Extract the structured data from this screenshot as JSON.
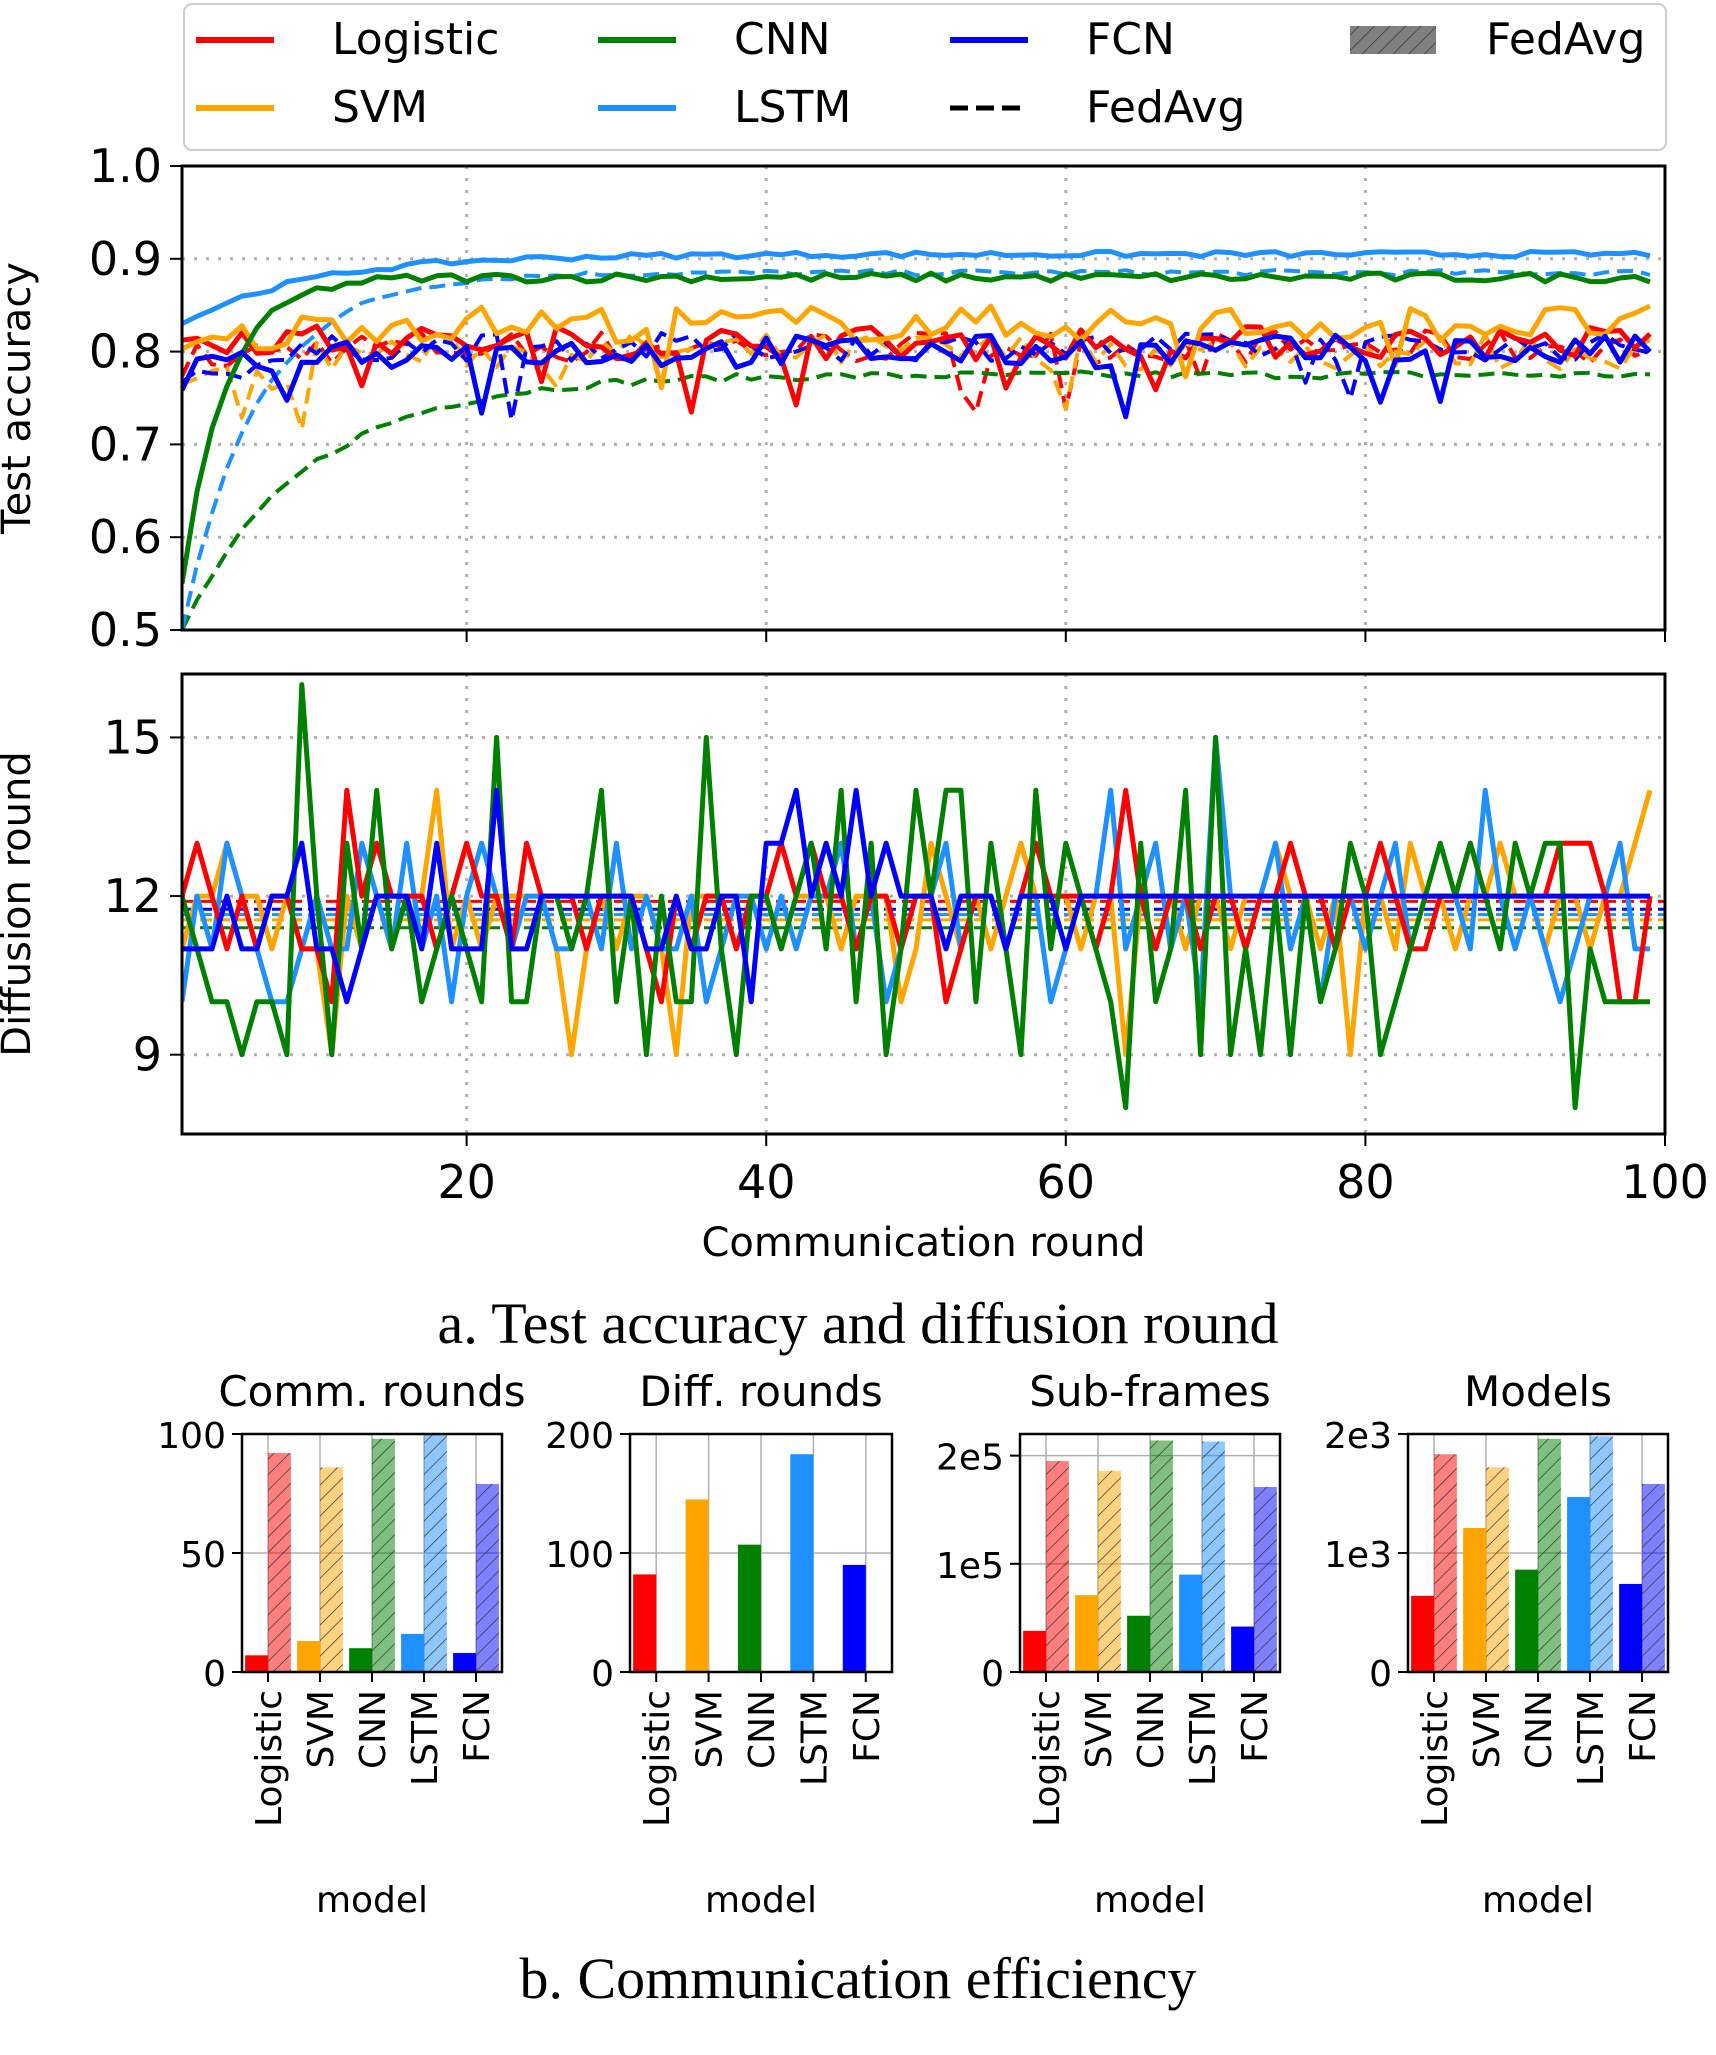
{
  "colors": {
    "Logistic": "#ff0000",
    "SVM": "#ffa500",
    "CNN": "#008000",
    "LSTM": "#1e90ff",
    "FCN": "#0000ff",
    "grid": "#b0b0b0",
    "fedavg_patch": "#808080"
  },
  "captions": {
    "a": "a. Test accuracy and diffusion round",
    "b": "b. Communication efficiency"
  },
  "legend": {
    "placement": "top (above plots)",
    "entries": [
      {
        "label": "Logistic",
        "kind": "line",
        "color_key": "Logistic"
      },
      {
        "label": "CNN",
        "kind": "line",
        "color_key": "CNN"
      },
      {
        "label": "FCN",
        "kind": "line",
        "color_key": "FCN"
      },
      {
        "label": "FedAvg",
        "kind": "hatch-patch",
        "color_key": "fedavg_patch"
      },
      {
        "label": "SVM",
        "kind": "line",
        "color_key": "SVM"
      },
      {
        "label": "LSTM",
        "kind": "line",
        "color_key": "LSTM"
      },
      {
        "label": "FedAvg",
        "kind": "dashed-line",
        "color_key": "black"
      }
    ]
  },
  "chart_data": [
    {
      "type": "line",
      "id": "test-accuracy",
      "ylabel": "Test accuracy",
      "xlabel": "",
      "xlim": [
        1,
        100
      ],
      "ylim": [
        0.5,
        1.0
      ],
      "xticks": [
        20,
        40,
        60,
        80,
        100
      ],
      "yticks": [
        0.5,
        0.6,
        0.7,
        0.8,
        0.9,
        1.0
      ],
      "ytick_labels": [
        "0.5",
        "0.6",
        "0.7",
        "0.8",
        "0.9",
        "1.0"
      ],
      "grid": true,
      "series": [
        {
          "name": "Logistic",
          "style": "solid",
          "profile": "noisy",
          "start": 0.82,
          "end": 0.81,
          "noise": 0.018
        },
        {
          "name": "SVM",
          "style": "solid",
          "profile": "noisy",
          "start": 0.8,
          "end": 0.83,
          "noise": 0.02
        },
        {
          "name": "CNN",
          "style": "solid",
          "profile": "rise",
          "start": 0.55,
          "end": 0.88,
          "k": 0.35,
          "mid": 0.77,
          "noise": 0.005
        },
        {
          "name": "LSTM",
          "style": "solid",
          "profile": "rise",
          "start": 0.83,
          "end": 0.905,
          "k": 0.12,
          "mid": 0.86,
          "noise": 0.003
        },
        {
          "name": "FCN",
          "style": "solid",
          "profile": "noisy",
          "start": 0.77,
          "end": 0.8,
          "noise": 0.018
        },
        {
          "name": "Logistic",
          "style": "dashed",
          "profile": "noisy",
          "start": 0.79,
          "end": 0.805,
          "noise": 0.018
        },
        {
          "name": "SVM",
          "style": "dashed",
          "profile": "noisy",
          "start": 0.75,
          "end": 0.8,
          "noise": 0.02
        },
        {
          "name": "CNN",
          "style": "dashed",
          "profile": "rise",
          "start": 0.5,
          "end": 0.775,
          "k": 0.12,
          "mid": 0.67,
          "noise": 0.004
        },
        {
          "name": "LSTM",
          "style": "dashed",
          "profile": "rise",
          "start": 0.5,
          "end": 0.885,
          "k": 0.2,
          "mid": 0.76,
          "noise": 0.003
        },
        {
          "name": "FCN",
          "style": "dashed",
          "profile": "noisy",
          "start": 0.77,
          "end": 0.805,
          "noise": 0.015
        }
      ]
    },
    {
      "type": "line",
      "id": "diffusion-round",
      "ylabel": "Diffusion round",
      "xlabel": "Communication round",
      "xlim": [
        1,
        100
      ],
      "ylim": [
        7.5,
        16.2
      ],
      "xticks": [
        20,
        40,
        60,
        80,
        100
      ],
      "yticks": [
        9,
        12,
        15
      ],
      "ytick_labels": [
        "9",
        "12",
        "15"
      ],
      "xtick_labels": [
        "20",
        "40",
        "60",
        "80",
        "100"
      ],
      "grid": true,
      "series": [
        {
          "name": "Logistic",
          "style": "solid",
          "values": [
            12,
            13,
            12,
            11,
            12,
            11,
            12,
            12,
            11,
            11,
            10,
            14,
            12,
            13,
            12,
            12,
            12,
            11,
            12,
            13,
            12,
            12,
            11,
            13,
            12,
            12,
            12,
            11,
            12,
            12,
            12,
            11,
            10,
            12,
            11,
            12,
            12,
            11,
            12,
            12,
            13,
            12,
            13,
            12,
            12,
            11,
            12,
            12,
            11,
            12,
            12,
            10,
            11,
            12,
            12,
            11,
            12,
            13,
            12,
            12,
            12,
            11,
            12,
            14,
            12,
            11,
            12,
            12,
            11,
            12,
            12,
            11,
            12,
            12,
            13,
            12,
            12,
            11,
            12,
            12,
            13,
            12,
            11,
            11,
            12,
            12,
            13,
            12,
            12,
            12,
            12,
            12,
            13,
            13,
            13,
            12,
            10,
            10,
            12
          ]
        },
        {
          "name": "SVM",
          "style": "solid",
          "values": [
            11,
            12,
            12,
            13,
            12,
            12,
            11,
            12,
            11,
            11,
            9,
            12,
            11,
            12,
            11,
            12,
            12,
            14,
            11,
            12,
            11,
            12,
            12,
            12,
            12,
            11,
            9,
            11,
            12,
            11,
            12,
            12,
            11,
            9,
            12,
            12,
            12,
            11,
            12,
            12,
            11,
            12,
            12,
            12,
            11,
            12,
            12,
            12,
            10,
            11,
            13,
            12,
            11,
            12,
            11,
            12,
            13,
            12,
            12,
            12,
            11,
            12,
            12,
            9,
            12,
            12,
            12,
            11,
            12,
            12,
            11,
            12,
            12,
            13,
            12,
            12,
            11,
            12,
            9,
            12,
            12,
            11,
            13,
            12,
            12,
            11,
            12,
            12,
            13,
            12,
            12,
            11,
            12,
            12,
            11,
            12,
            12,
            13,
            14
          ]
        },
        {
          "name": "CNN",
          "style": "solid",
          "values": [
            12,
            11,
            10,
            10,
            9,
            10,
            10,
            9,
            16,
            12,
            9,
            13,
            11,
            14,
            11,
            12,
            10,
            11,
            12,
            11,
            10,
            15,
            10,
            10,
            12,
            12,
            11,
            12,
            14,
            10,
            12,
            9,
            12,
            10,
            10,
            15,
            11,
            9,
            12,
            12,
            11,
            12,
            13,
            11,
            14,
            10,
            13,
            9,
            11,
            14,
            12,
            14,
            14,
            10,
            13,
            11,
            9,
            14,
            11,
            13,
            12,
            11,
            10,
            8,
            13,
            10,
            11,
            14,
            9,
            15,
            9,
            11,
            9,
            12,
            9,
            12,
            10,
            11,
            13,
            12,
            9,
            10,
            11,
            12,
            13,
            12,
            13,
            12,
            11,
            13,
            12,
            13,
            13,
            8,
            11,
            10,
            10,
            10,
            10
          ]
        },
        {
          "name": "LSTM",
          "style": "solid",
          "values": [
            10,
            12,
            11,
            13,
            12,
            11,
            10,
            10,
            11,
            12,
            11,
            11,
            13,
            12,
            11,
            13,
            11,
            12,
            10,
            12,
            13,
            12,
            11,
            12,
            12,
            11,
            11,
            12,
            11,
            13,
            11,
            12,
            11,
            11,
            12,
            10,
            11,
            12,
            12,
            11,
            12,
            11,
            12,
            12,
            13,
            11,
            12,
            10,
            11,
            12,
            12,
            13,
            11,
            12,
            12,
            11,
            12,
            12,
            10,
            11,
            12,
            12,
            14,
            11,
            12,
            13,
            11,
            12,
            10,
            15,
            12,
            11,
            12,
            13,
            11,
            12,
            10,
            12,
            12,
            11,
            12,
            13,
            11,
            12,
            12,
            12,
            11,
            14,
            12,
            11,
            12,
            11,
            10,
            11,
            12,
            12,
            13,
            11,
            11
          ]
        },
        {
          "name": "FCN",
          "style": "solid",
          "values": [
            11,
            11,
            11,
            12,
            11,
            11,
            12,
            12,
            13,
            11,
            11,
            10,
            11,
            12,
            12,
            12,
            11,
            13,
            11,
            11,
            11,
            14,
            11,
            11,
            12,
            12,
            12,
            12,
            12,
            12,
            12,
            11,
            11,
            12,
            11,
            11,
            12,
            12,
            10,
            13,
            13,
            14,
            12,
            13,
            12,
            14,
            12,
            13,
            12,
            12,
            12,
            11,
            12,
            12,
            12,
            11,
            12,
            12,
            12,
            11,
            12,
            12,
            12,
            12,
            12,
            12,
            12,
            12,
            12,
            12,
            12,
            12,
            12,
            12,
            12,
            12,
            12,
            12,
            12,
            12,
            12,
            12,
            12,
            12,
            12,
            12,
            12,
            12,
            12,
            12,
            12,
            12,
            12,
            12,
            12,
            12,
            12,
            12,
            12
          ]
        },
        {
          "name": "Logistic",
          "style": "dashed",
          "mean": 11.9
        },
        {
          "name": "SVM",
          "style": "dashed",
          "mean": 11.55
        },
        {
          "name": "CNN",
          "style": "dashed",
          "mean": 11.4
        },
        {
          "name": "LSTM",
          "style": "dashed",
          "mean": 11.65
        },
        {
          "name": "FCN",
          "style": "dashed",
          "mean": 11.75
        }
      ]
    },
    {
      "type": "bar",
      "id": "comm-rounds",
      "title": "Comm. rounds",
      "xlabel": "model",
      "categories": [
        "Logistic",
        "SVM",
        "CNN",
        "LSTM",
        "FCN"
      ],
      "series": [
        {
          "name": "",
          "values": [
            7,
            13,
            10,
            16,
            8
          ]
        },
        {
          "name": "FedAvg",
          "values": [
            92,
            86,
            98,
            100,
            79
          ]
        }
      ],
      "ylim": [
        0,
        100
      ],
      "yticks": [
        0,
        50,
        100
      ],
      "ytick_labels": [
        "0",
        "50",
        "100"
      ],
      "grid": true
    },
    {
      "type": "bar",
      "id": "diff-rounds",
      "title": "Diff. rounds",
      "xlabel": "model",
      "categories": [
        "Logistic",
        "SVM",
        "CNN",
        "LSTM",
        "FCN"
      ],
      "series": [
        {
          "name": "",
          "values": [
            82,
            145,
            107,
            183,
            90
          ]
        }
      ],
      "ylim": [
        0,
        200
      ],
      "yticks": [
        0,
        100,
        200
      ],
      "ytick_labels": [
        "0",
        "100",
        "200"
      ],
      "grid": true
    },
    {
      "type": "bar",
      "id": "sub-frames",
      "title": "Sub-frames",
      "xlabel": "model",
      "categories": [
        "Logistic",
        "SVM",
        "CNN",
        "LSTM",
        "FCN"
      ],
      "series": [
        {
          "name": "",
          "values": [
            38000,
            71000,
            52000,
            90000,
            42000
          ]
        },
        {
          "name": "FedAvg",
          "values": [
            195000,
            186000,
            214000,
            213000,
            171000
          ]
        }
      ],
      "ylim": [
        0,
        220000
      ],
      "yticks": [
        0,
        100000,
        200000
      ],
      "ytick_labels": [
        "0",
        "1e5",
        "2e5"
      ],
      "grid": true
    },
    {
      "type": "bar",
      "id": "models",
      "title": "Models",
      "xlabel": "model",
      "categories": [
        "Logistic",
        "SVM",
        "CNN",
        "LSTM",
        "FCN"
      ],
      "series": [
        {
          "name": "",
          "values": [
            640,
            1210,
            860,
            1470,
            740
          ]
        },
        {
          "name": "FedAvg",
          "values": [
            1830,
            1720,
            1960,
            1980,
            1580
          ]
        }
      ],
      "ylim": [
        0,
        2000
      ],
      "yticks": [
        0,
        1000,
        2000
      ],
      "ytick_labels": [
        "0",
        "1e3",
        "2e3"
      ],
      "grid": true
    }
  ]
}
